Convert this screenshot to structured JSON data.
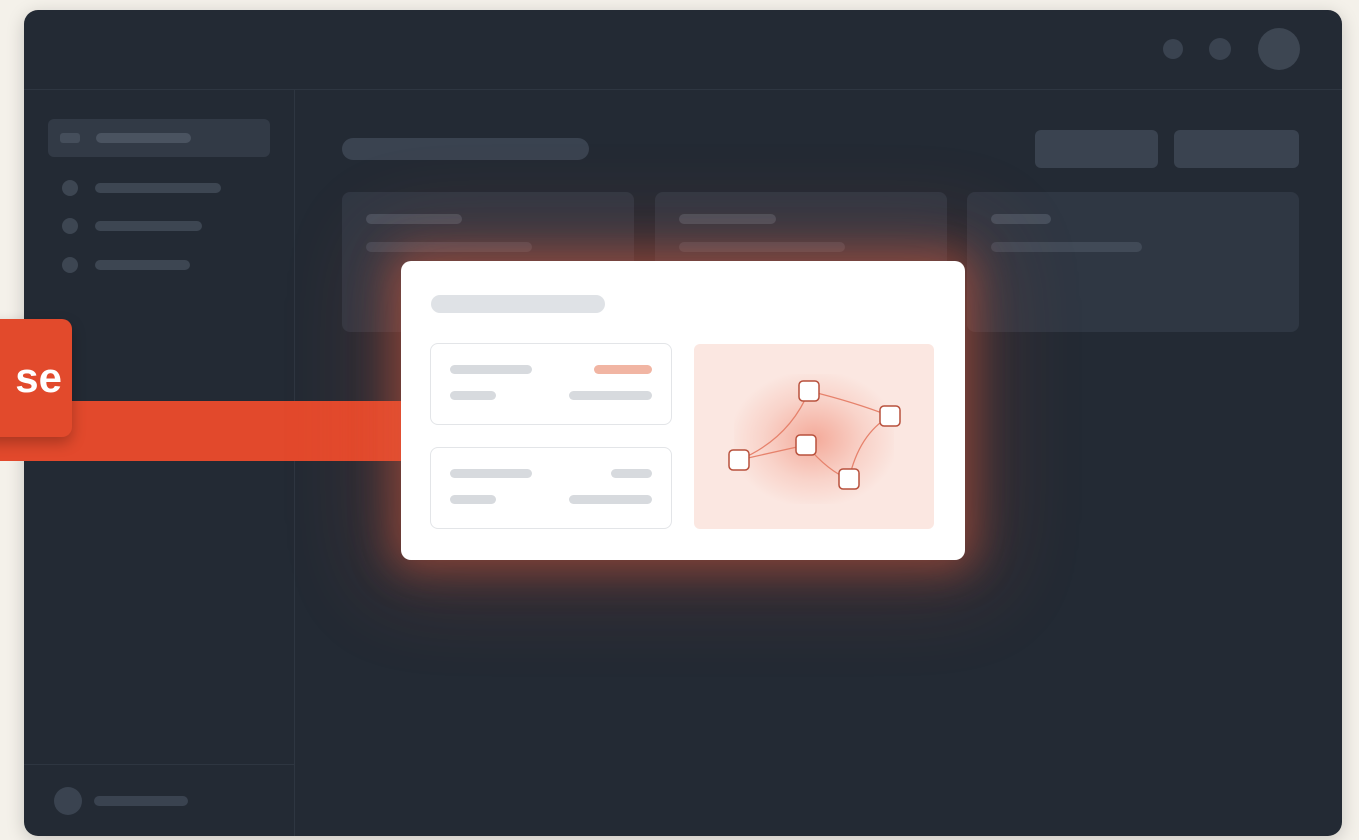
{
  "callout": {
    "label": "se",
    "color": "#e2492c"
  },
  "theme": {
    "window_bg": "#232a34",
    "page_bg": "#f4f1ea",
    "accent": "#e2492c",
    "modal_bg": "#ffffff",
    "graph_panel_bg": "#fbe7e1"
  },
  "titlebar": {
    "icons": [
      "circle-icon",
      "circle-icon",
      "avatar"
    ]
  },
  "sidebar": {
    "active_item_icon": "menu-icon",
    "item_count": 4
  },
  "modal": {
    "graph_icon": "network-graph-icon"
  }
}
